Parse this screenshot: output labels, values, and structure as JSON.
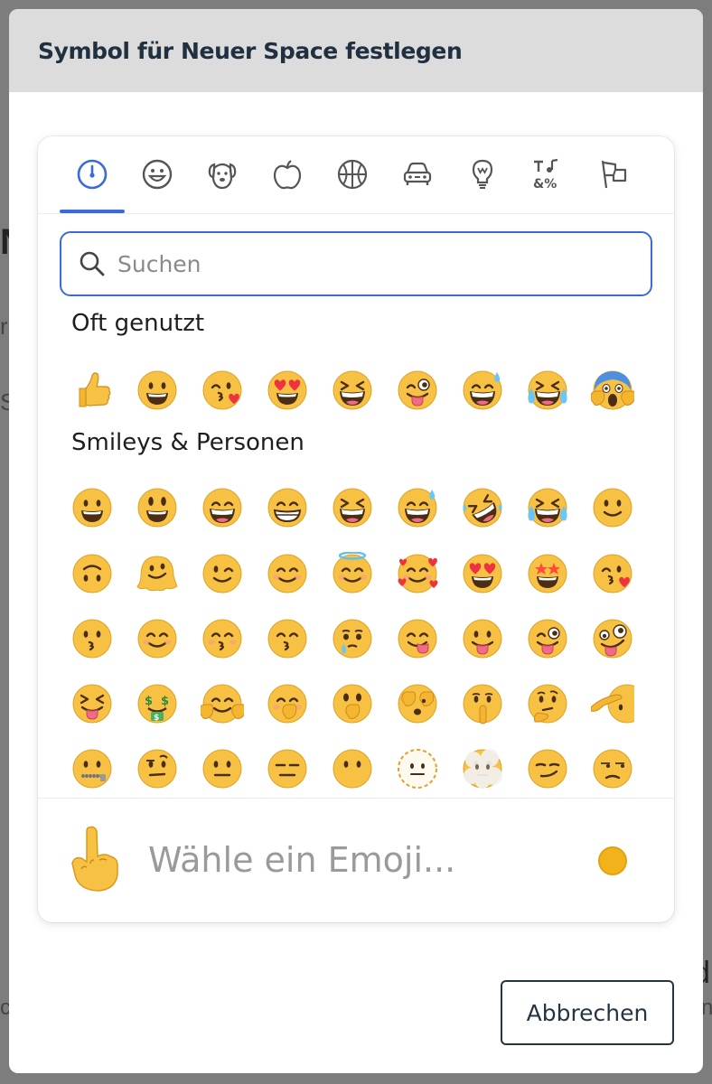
{
  "background": {
    "fragments": [
      "N",
      "r",
      "S",
      "d",
      "c",
      "n"
    ]
  },
  "dialog": {
    "title": "Symbol für Neuer Space festlegen",
    "cancel_label": "Abbrechen"
  },
  "picker": {
    "categories": [
      {
        "icon": "clock-icon",
        "active": true
      },
      {
        "icon": "smiley-icon",
        "active": false
      },
      {
        "icon": "dog-icon",
        "active": false
      },
      {
        "icon": "apple-icon",
        "active": false
      },
      {
        "icon": "basketball-icon",
        "active": false
      },
      {
        "icon": "car-icon",
        "active": false
      },
      {
        "icon": "lightbulb-icon",
        "active": false
      },
      {
        "icon": "symbols-icon",
        "active": false
      },
      {
        "icon": "flag-icon",
        "active": false
      }
    ],
    "search": {
      "placeholder": "Suchen",
      "value": ""
    },
    "sections": [
      {
        "title": "Oft genutzt",
        "rows": [
          [
            "thumbs-up",
            "grinning-face",
            "face-blowing-kiss",
            "heart-eyes",
            "squinting-laugh",
            "winking-tongue",
            "sweat-smile",
            "tears-of-joy",
            "screaming-in-fear"
          ]
        ]
      },
      {
        "title": "Smileys & Personen",
        "rows": [
          [
            "grinning-face",
            "grinning-big-eyes",
            "grinning-smiling-eyes",
            "beaming-face",
            "squinting-laugh",
            "sweat-smile",
            "rolling-on-floor-laughing",
            "tears-of-joy",
            "slightly-smiling"
          ],
          [
            "upside-down",
            "melting-face",
            "winking-face",
            "smiling-eyes",
            "halo",
            "smiling-with-hearts",
            "heart-eyes",
            "star-struck",
            "face-blowing-kiss"
          ],
          [
            "kissing-face",
            "smiling-relaxed",
            "kissing-closed-eyes",
            "kissing-smiling-eyes",
            "holding-back-tears",
            "savoring-food",
            "tongue-out",
            "winking-tongue",
            "zany-face"
          ],
          [
            "squinting-tongue",
            "money-mouth",
            "hugging-face",
            "hand-over-mouth",
            "open-eyes-hand-over-mouth",
            "peeking-eye",
            "shushing-face",
            "thinking-face",
            "saluting-face"
          ],
          [
            "zipper-mouth",
            "raised-eyebrow",
            "neutral-face",
            "expressionless",
            "no-mouth",
            "dotted-line-face",
            "face-in-clouds",
            "smirking-face",
            "unamused-face"
          ]
        ]
      }
    ],
    "preview": {
      "icon": "pointing-up-icon",
      "placeholder": "Wähle ein Emoji...",
      "skin_tone_color": "#f2b21b"
    }
  },
  "colors": {
    "accent": "#3a6bd9",
    "emoji_yellow": "#f7c244",
    "header_bg": "#dcdcdc",
    "title_text": "#203040"
  }
}
